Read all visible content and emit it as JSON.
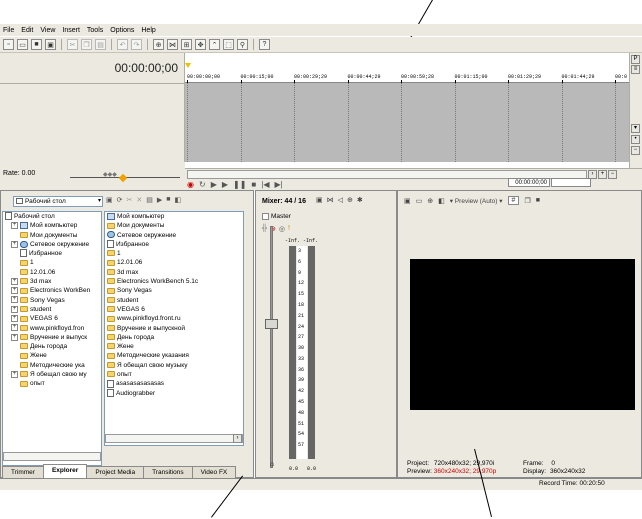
{
  "menu": [
    "File",
    "Edit",
    "View",
    "Insert",
    "Tools",
    "Options",
    "Help"
  ],
  "toolbar_icons": [
    "new-icon",
    "open-icon",
    "save-icon",
    "properties-icon",
    "cut-icon",
    "copy-icon",
    "paste-icon",
    "undo-icon",
    "redo-icon",
    "enable-snapping-icon",
    "auto-crossfades-icon",
    "ignore-grouping-icon",
    "normal-edit-tool-icon",
    "envelope-tool-icon",
    "selection-tool-icon",
    "zoom-tool-icon",
    "what-is-this-icon"
  ],
  "timeline": {
    "timecode": "00:00:00;00",
    "rate": "Rate: 0.00",
    "ruler": [
      "00:00:00;00",
      "00:00:15;00",
      "00:00:29;29",
      "00:00:44;29",
      "00:00:59;28",
      "00:01:15;00",
      "00:01:29;29",
      "00:01:44;29",
      "00:0"
    ],
    "transport_timecode": "00:00:00;00"
  },
  "explorer": {
    "location": "Рабочий стол",
    "tree": [
      {
        "label": "Рабочий стол",
        "icon": "desktop-icon",
        "indent": 0,
        "expander": ""
      },
      {
        "label": "Мой компьютер",
        "icon": "computer-icon",
        "indent": 1,
        "expander": "+"
      },
      {
        "label": "Мои документы",
        "icon": "folder-icon",
        "indent": 1,
        "expander": ""
      },
      {
        "label": "Сетевое окружение",
        "icon": "network-icon",
        "indent": 1,
        "expander": "+"
      },
      {
        "label": "Избранное",
        "icon": "favorites-icon",
        "indent": 1,
        "expander": ""
      },
      {
        "label": "1",
        "icon": "folder-icon",
        "indent": 1,
        "expander": ""
      },
      {
        "label": "12.01.06",
        "icon": "folder-icon",
        "indent": 1,
        "expander": ""
      },
      {
        "label": "3d max",
        "icon": "folder-icon",
        "indent": 1,
        "expander": "+"
      },
      {
        "label": "Electronics WorkBen",
        "icon": "folder-icon",
        "indent": 1,
        "expander": "+"
      },
      {
        "label": "Sony Vegas",
        "icon": "folder-icon",
        "indent": 1,
        "expander": "+"
      },
      {
        "label": "student",
        "icon": "folder-icon",
        "indent": 1,
        "expander": "+"
      },
      {
        "label": "VEGAS 6",
        "icon": "folder-icon",
        "indent": 1,
        "expander": "+"
      },
      {
        "label": "www.pinkfloyd.fron",
        "icon": "folder-icon",
        "indent": 1,
        "expander": "+"
      },
      {
        "label": "Вручение и выпуск",
        "icon": "folder-icon",
        "indent": 1,
        "expander": "+"
      },
      {
        "label": "День города",
        "icon": "folder-icon",
        "indent": 1,
        "expander": ""
      },
      {
        "label": "Жене",
        "icon": "folder-icon",
        "indent": 1,
        "expander": ""
      },
      {
        "label": "Методические ука",
        "icon": "folder-icon",
        "indent": 1,
        "expander": ""
      },
      {
        "label": "Я обещал свою му",
        "icon": "folder-icon",
        "indent": 1,
        "expander": "+"
      },
      {
        "label": "опыт",
        "icon": "folder-icon",
        "indent": 1,
        "expander": ""
      }
    ],
    "files": [
      {
        "label": "Мой компьютер",
        "icon": "computer-icon"
      },
      {
        "label": "Мои документы",
        "icon": "folder-icon"
      },
      {
        "label": "Сетевое окружение",
        "icon": "network-icon"
      },
      {
        "label": "Избранное",
        "icon": "favorites-icon"
      },
      {
        "label": "1",
        "icon": "folder-icon"
      },
      {
        "label": "12.01.06",
        "icon": "folder-icon"
      },
      {
        "label": "3d max",
        "icon": "folder-icon"
      },
      {
        "label": "Electronics WorkBench 5.1c",
        "icon": "folder-icon"
      },
      {
        "label": "Sony Vegas",
        "icon": "folder-icon"
      },
      {
        "label": "student",
        "icon": "folder-icon"
      },
      {
        "label": "VEGAS 6",
        "icon": "folder-icon"
      },
      {
        "label": "www.pinkfloyd.front.ru",
        "icon": "folder-icon"
      },
      {
        "label": "Вручение и выпускной",
        "icon": "folder-icon"
      },
      {
        "label": "День города",
        "icon": "folder-icon"
      },
      {
        "label": "Жене",
        "icon": "folder-icon"
      },
      {
        "label": "Методические указания",
        "icon": "folder-icon"
      },
      {
        "label": "Я обещал свою музыку",
        "icon": "folder-icon"
      },
      {
        "label": "опыт",
        "icon": "folder-icon"
      },
      {
        "label": "asasasasasasas",
        "icon": "file-icon"
      },
      {
        "label": "Audiograbber",
        "icon": "file-icon"
      }
    ]
  },
  "tabs": [
    {
      "label": "Trimmer",
      "active": false
    },
    {
      "label": "Explorer",
      "active": true
    },
    {
      "label": "Project Media",
      "active": false
    },
    {
      "label": "Transitions",
      "active": false
    },
    {
      "label": "Video FX",
      "active": false
    }
  ],
  "mixer": {
    "title": "Mixer: 44 / 16",
    "master": "Master",
    "left_level": "-Inf.",
    "right_level": "-Inf.",
    "scale": [
      "3",
      "6",
      "9",
      "12",
      "15",
      "18",
      "21",
      "24",
      "27",
      "30",
      "33",
      "36",
      "39",
      "42",
      "45",
      "48",
      "51",
      "54",
      "57"
    ],
    "left_value": "0.0",
    "right_value": "0.0"
  },
  "preview": {
    "mode": "Preview (Auto)",
    "project_label": "Project:",
    "project_value": "720x480x32; 29,970i",
    "preview_label": "Preview:",
    "preview_value": "360x240x32; 29,970p",
    "frame_label": "Frame:",
    "frame_value": "0",
    "display_label": "Display:",
    "display_value": "360x240x32",
    "record_time": "Record Time: 00:20:50",
    "preview_color": "#cc0000"
  }
}
